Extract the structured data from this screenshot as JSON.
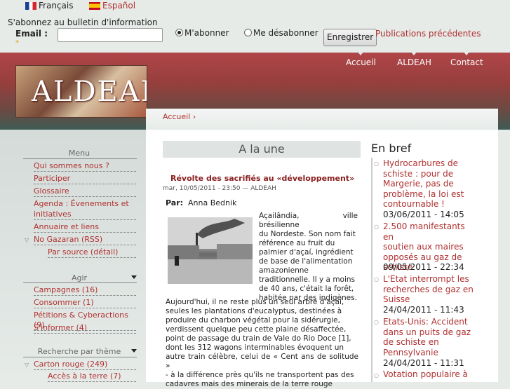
{
  "languages": {
    "fr": "Français",
    "es": "Español"
  },
  "newsletter": {
    "text": "S'abonnez au bulletin d'information",
    "email_label": "Email :",
    "required_mark": "*",
    "radio_subscribe": "M'abonner",
    "radio_unsubscribe": "Me désabonner",
    "submit": "Enregistrer",
    "previous": "Publications précédentes"
  },
  "header": {
    "logo_text": "ALDEAH"
  },
  "nav": {
    "items": [
      "Accueil",
      "ALDEAH",
      "Contact"
    ]
  },
  "breadcrumb": "Accueil ›",
  "sidebar": {
    "menu_title": "Menu",
    "menu_items": [
      "Qui sommes nous ?",
      "Participer",
      "Glossaire",
      "Agenda : Évenements et",
      "initiatives",
      "Annuaire et liens",
      "No Gazaran (RSS)",
      "Par source (détail)"
    ],
    "agir_title": "Agir",
    "agir_items": [
      "Campagnes (16)",
      "Consommer (1)",
      "Pétitions & Cyberactions (9)",
      "S'informer (4)"
    ],
    "search_title": "Recherche par thème",
    "search_items": [
      "Carton rouge (249)",
      "Accès à la terre (7)"
    ]
  },
  "main": {
    "heading": "A la une",
    "article": {
      "title": "Révolte des sacrifiés au «développement»",
      "meta": "mar, 10/05/2011 - 23:50 — ALDEAH",
      "by_label": "Par:",
      "by_name": "Anna Bednik",
      "side_lines": [
        "Açailândia, ville brésilienne",
        "du Nordeste. Son nom fait",
        "référence au fruit du",
        "palmier d'açaí, ingrédient",
        "de base de l'alimentation",
        "amazonienne",
        "traditionnelle. Il y a moins",
        "de 40 ans, c'était la forêt,",
        "habitée par des indigènes."
      ],
      "full_lines": [
        "Aujourd'hui, il ne reste plus un seul arbre d'açaí,",
        "seules les plantations d'eucalyptus, destinées à",
        "produire du charbon végétal pour la sidérurgie,",
        "verdissent quelque peu cette plaine désaffectée,",
        "point de passage du train de Vale do Rio Doce [1],",
        "dont les 312 wagons interminables évoquent un",
        "autre train célèbre, celui de « Cent ans de solitude »",
        "- à la différence près qu'ils ne transportent pas des",
        "cadavres mais des minerais de la terre rouge"
      ]
    }
  },
  "enbref": {
    "title": "En bref",
    "items": [
      {
        "lines": [
          "Hydrocarbures de",
          "schiste : pour de",
          "Margerie, pas de",
          "problème, la loi est",
          "contournable !"
        ],
        "date": "03/06/2011 - 14:05"
      },
      {
        "lines": [
          "2.500 manifestants en",
          "soutien aux maires",
          "opposés au gaz de",
          "schiste"
        ],
        "date": "09/05/2011 - 22:34"
      },
      {
        "lines": [
          "L'Etat interrompt les",
          "recherches de gaz en",
          "Suisse"
        ],
        "date": "24/04/2011 - 11:43"
      },
      {
        "lines": [
          "Etats-Unis: Accident",
          "dans un puits de gaz",
          "de schiste en",
          "Pennsylvanie"
        ],
        "date": "24/04/2011 - 11:31"
      },
      {
        "lines": [
          "Votation populaire à"
        ],
        "date": ""
      }
    ]
  }
}
